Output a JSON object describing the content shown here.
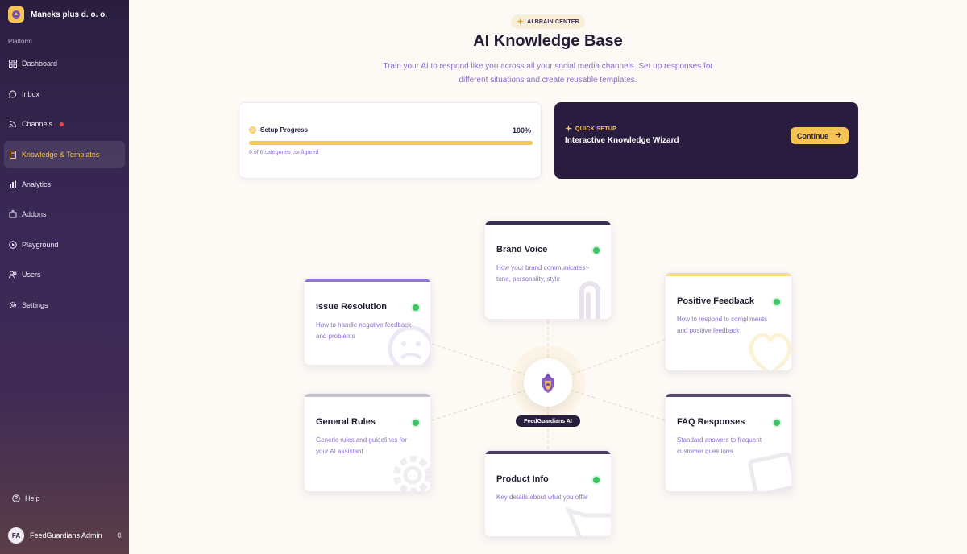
{
  "sidebar": {
    "org_name": "Maneks plus d. o. o.",
    "section_label": "Platform",
    "items": [
      {
        "label": "Dashboard",
        "icon": "grid-icon"
      },
      {
        "label": "Inbox",
        "icon": "chat-bubble-icon"
      },
      {
        "label": "Channels",
        "icon": "rss-icon",
        "alert": true
      },
      {
        "label": "Knowledge & Templates",
        "icon": "book-icon",
        "active": true
      },
      {
        "label": "Analytics",
        "icon": "bar-chart-icon"
      },
      {
        "label": "Addons",
        "icon": "puzzle-icon"
      },
      {
        "label": "Playground",
        "icon": "play-icon"
      },
      {
        "label": "Users",
        "icon": "users-icon"
      },
      {
        "label": "Settings",
        "icon": "gear-icon"
      }
    ],
    "help_label": "Help",
    "user": {
      "initials": "FA",
      "name": "FeedGuardians Admin"
    }
  },
  "header": {
    "badge": "AI BRAIN CENTER",
    "title": "AI Knowledge Base",
    "subtitle": "Train your AI to respond like you across all your social media channels. Set up responses for different situations and create reusable templates."
  },
  "progress": {
    "label": "Setup Progress",
    "percent_text": "100%",
    "fraction": 1.0,
    "sub": "6 of 6 categories configured"
  },
  "wizard": {
    "kicker": "QUICK SETUP",
    "title": "Interactive Knowledge Wizard",
    "button": "Continue"
  },
  "hub": {
    "label": "FeedGuardians AI"
  },
  "colors": {
    "accent": "#f6c454",
    "sidebar_dark": "#2a1e3f",
    "purple_text": "#8b6fc7",
    "status_green": "#3cc463"
  },
  "cards": {
    "brand_voice": {
      "title": "Brand Voice",
      "desc": "How your brand communicates - tone, personality, style",
      "watermark": "paperclip-icon"
    },
    "issue_resolution": {
      "title": "Issue Resolution",
      "desc": "How to handle negative feedback and problems",
      "watermark": "sad-face-icon"
    },
    "positive_feedback": {
      "title": "Positive Feedback",
      "desc": "How to respond to compliments and positive feedback",
      "watermark": "heart-icon"
    },
    "general_rules": {
      "title": "General Rules",
      "desc": "Generic rules and guidelines for your AI assistant",
      "watermark": "gear-icon"
    },
    "faq_responses": {
      "title": "FAQ Responses",
      "desc": "Standard answers to frequent customer questions",
      "watermark": "document-icon"
    },
    "product_info": {
      "title": "Product Info",
      "desc": "Key details about what you offer",
      "watermark": "box-icon"
    }
  }
}
